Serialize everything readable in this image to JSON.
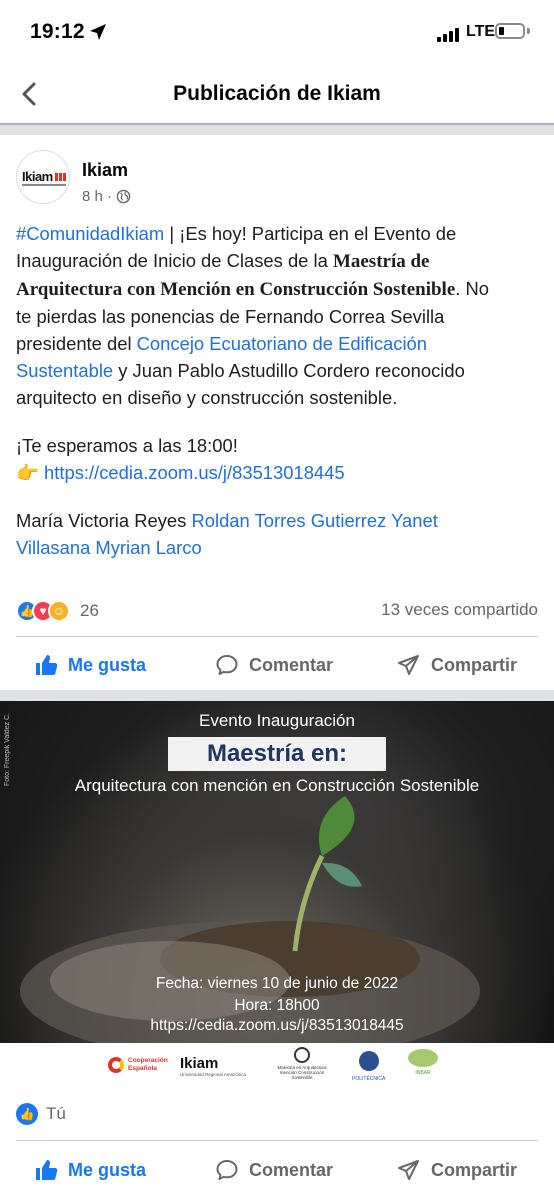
{
  "status": {
    "time": "19:12",
    "network": "LTE"
  },
  "nav": {
    "title": "Publicación de Ikiam"
  },
  "post": {
    "page_name": "Ikiam",
    "time_ago": "8 h",
    "avatar_text": "Ikiam",
    "lines": [
      {
        "a_link": "#ComunidadIkiam",
        "b": " | ¡Es hoy! Participa en el Evento de"
      },
      {
        "a": "Inauguración de Inicio de Clases de la ",
        "b_serif": "Maestría de"
      },
      {
        "a_serif": "Arquitectura con Mención en Construcción Sostenible",
        "b": ". No"
      },
      {
        "a": "te pierdas las ponencias de Fernando Correa Sevilla"
      },
      {
        "a": "presidente del ",
        "b_link": "Concejo Ecuatoriano de Edificación"
      },
      {
        "a_link": "Sustentable",
        "b": " y Juan Pablo Astudillo Cordero reconocido"
      },
      {
        "a": "arquitecto en diseño y construcción sostenible."
      }
    ],
    "wait_text": "¡Te esperamos a las 18:00!",
    "zoom_emoji": "👉",
    "zoom_link": "https://cedia.zoom.us/j/83513018445",
    "tags_line1_plain": "María Victoria Reyes ",
    "tags_line1_link": "Roldan Torres Gutierrez Yanet",
    "tags_line2_link": "Villasana Myrian Larco",
    "reaction_count": "26",
    "shares": "13 veces compartido"
  },
  "actions": {
    "like": "Me gusta",
    "comment": "Comentar",
    "share": "Compartir"
  },
  "photo": {
    "credit": "Foto: Freepik Valdez C.",
    "title": "Evento Inauguración",
    "banner": "Maestría en:",
    "subtitle": "Arquitectura con mención  en Construcción Sostenible",
    "date": "Fecha: viernes 10 de junio de 2022",
    "hour": "Hora: 18h00",
    "link": "https://cedia.zoom.us/j/83513018445",
    "logos": {
      "cooperacion": "Cooperación Española",
      "ikiam": "Ikiam",
      "ikiam_sub": "Universidad Regional Amazónica",
      "maestria": "Maestría en Arquitectura mención Construcción Sostenible",
      "poli": "POLITÉCNICA",
      "inbar": "INBAR"
    }
  },
  "footer": {
    "you": "Tú"
  },
  "colors": {
    "brand_blue": "#1877f2",
    "link_blue": "#216fdb",
    "banner_navy": "#20365f"
  }
}
